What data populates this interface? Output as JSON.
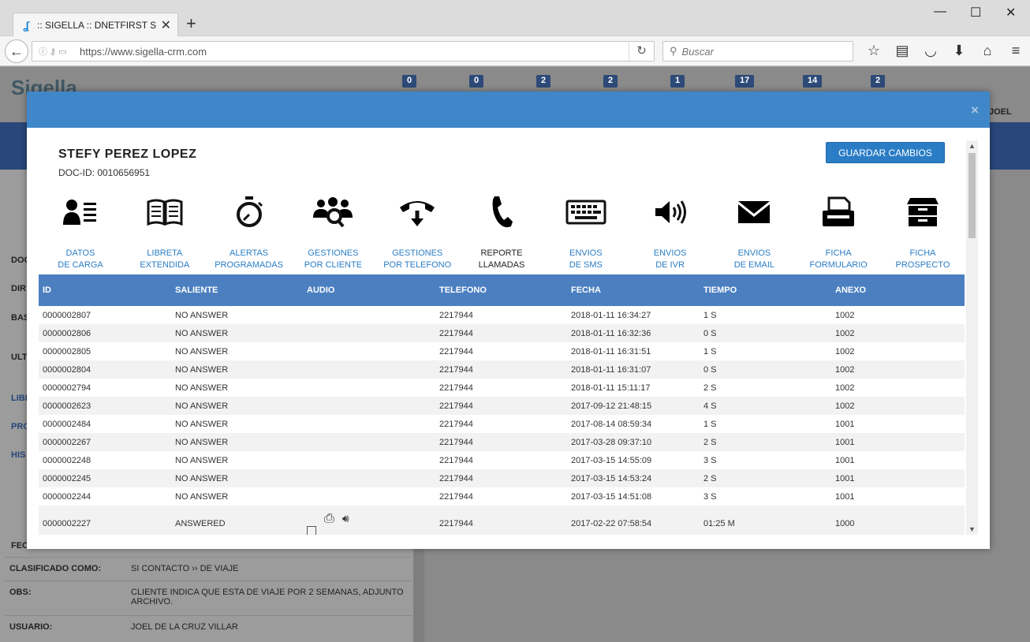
{
  "browser": {
    "tab_title": ":: SIGELLA :: DNETFIRST S....",
    "url": "https://www.sigella-crm.com",
    "search_placeholder": "Buscar"
  },
  "background": {
    "logo": "Sigella",
    "badges": [
      "0",
      "0",
      "2",
      "2",
      "1",
      "17",
      "14",
      "2"
    ],
    "user": "JOEL",
    "left_labels": [
      "DOC",
      "DIR",
      "BAS",
      "ULT",
      "LIBR",
      "PRO",
      "HIS",
      "FEC"
    ],
    "detail_rows": [
      {
        "key": "CLASIFICADO COMO:",
        "value": "SI CONTACTO ›› DE VIAJE"
      },
      {
        "key": "OBS:",
        "value": "CLIENTE INDICA QUE ESTA DE VIAJE POR 2 SEMANAS, ADJUNTO ARCHIVO."
      },
      {
        "key": "USUARIO:",
        "value": "JOEL DE LA CRUZ VILLAR"
      }
    ]
  },
  "modal": {
    "close": "×",
    "client_name": "STEFY PEREZ LOPEZ",
    "doc_id": "DOC-ID: 0010656951",
    "save_label": "GUARDAR CAMBIOS",
    "icons": [
      {
        "l1": "DATOS",
        "l2": "DE CARGA",
        "icon": "contact-card-icon"
      },
      {
        "l1": "LIBRETA",
        "l2": "EXTENDIDA",
        "icon": "open-book-icon"
      },
      {
        "l1": "ALERTAS",
        "l2": "PROGRAMADAS",
        "icon": "stopwatch-icon"
      },
      {
        "l1": "GESTIONES",
        "l2": "POR CLIENTE",
        "icon": "users-search-icon"
      },
      {
        "l1": "GESTIONES",
        "l2": "POR TELEFONO",
        "icon": "phone-hangup-icon"
      },
      {
        "l1": "REPORTE",
        "l2": "LLAMADAS",
        "icon": "phone-icon"
      },
      {
        "l1": "ENVIOS",
        "l2": "DE SMS",
        "icon": "keyboard-icon"
      },
      {
        "l1": "ENVIOS",
        "l2": "DE IVR",
        "icon": "speaker-icon"
      },
      {
        "l1": "ENVIOS",
        "l2": "DE EMAIL",
        "icon": "envelope-icon"
      },
      {
        "l1": "FICHA",
        "l2": "FORMULARIO",
        "icon": "fax-icon"
      },
      {
        "l1": "FICHA",
        "l2": "PROSPECTO",
        "icon": "archive-icon"
      }
    ],
    "table": {
      "headers": [
        "ID",
        "SALIENTE",
        "AUDIO",
        "TELEFONO",
        "FECHA",
        "TIEMPO",
        "ANEXO"
      ],
      "rows": [
        [
          "0000002807",
          "NO ANSWER",
          "",
          "2217944",
          "2018-01-11 16:34:27",
          "1 S",
          "1002"
        ],
        [
          "0000002806",
          "NO ANSWER",
          "",
          "2217944",
          "2018-01-11 16:32:36",
          "0 S",
          "1002"
        ],
        [
          "0000002805",
          "NO ANSWER",
          "",
          "2217944",
          "2018-01-11 16:31:51",
          "1 S",
          "1002"
        ],
        [
          "0000002804",
          "NO ANSWER",
          "",
          "2217944",
          "2018-01-11 16:31:07",
          "0 S",
          "1002"
        ],
        [
          "0000002794",
          "NO ANSWER",
          "",
          "2217944",
          "2018-01-11 15:11:17",
          "2 S",
          "1002"
        ],
        [
          "0000002623",
          "NO ANSWER",
          "",
          "2217944",
          "2017-09-12 21:48:15",
          "4 S",
          "1002"
        ],
        [
          "0000002484",
          "NO ANSWER",
          "",
          "2217944",
          "2017-08-14 08:59:34",
          "1 S",
          "1001"
        ],
        [
          "0000002267",
          "NO ANSWER",
          "",
          "2217944",
          "2017-03-28 09:37:10",
          "2 S",
          "1001"
        ],
        [
          "0000002248",
          "NO ANSWER",
          "",
          "2217944",
          "2017-03-15 14:55:09",
          "3 S",
          "1001"
        ],
        [
          "0000002245",
          "NO ANSWER",
          "",
          "2217944",
          "2017-03-15 14:53:24",
          "2 S",
          "1001"
        ],
        [
          "0000002244",
          "NO ANSWER",
          "",
          "2217944",
          "2017-03-15 14:51:08",
          "3 S",
          "1001"
        ],
        [
          "0000002227",
          "ANSWERED",
          "audio",
          "2217944",
          "2017-02-22 07:58:54",
          "01:25 M",
          "1000"
        ]
      ]
    }
  }
}
